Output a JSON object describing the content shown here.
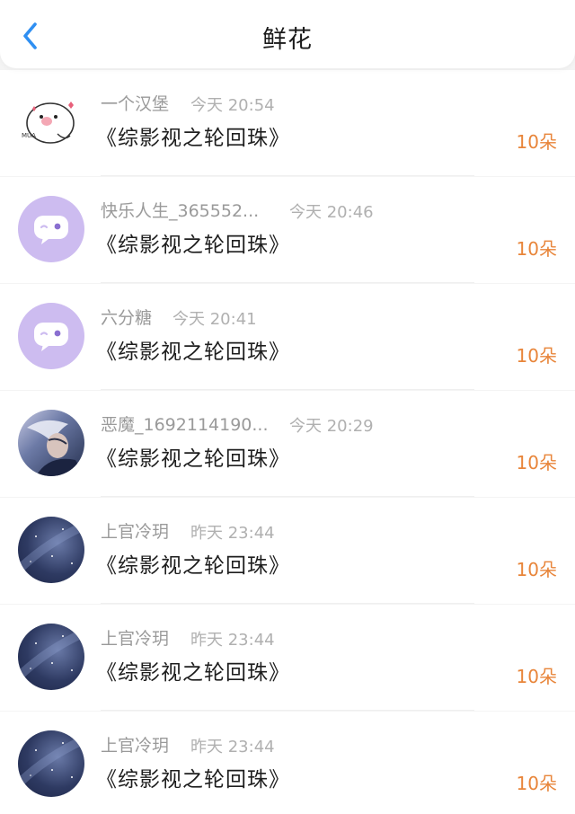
{
  "header": {
    "title": "鲜花",
    "accent_color": "#2f8ff2"
  },
  "items": [
    {
      "name": "一个汉堡",
      "time": "今天 20:54",
      "book": "《综影视之轮回珠》",
      "count": "10朵",
      "avatar": "cartoon-sticker"
    },
    {
      "name": "快乐人生_365552...",
      "time": "今天 20:46",
      "book": "《综影视之轮回珠》",
      "count": "10朵",
      "avatar": "purple-chat-bubble"
    },
    {
      "name": "六分糖",
      "time": "今天 20:41",
      "book": "《综影视之轮回珠》",
      "count": "10朵",
      "avatar": "purple-chat-bubble"
    },
    {
      "name": "恶魔_1692114190...",
      "time": "今天 20:29",
      "book": "《综影视之轮回珠》",
      "count": "10朵",
      "avatar": "anime-character"
    },
    {
      "name": "上官冷玥",
      "time": "昨天 23:44",
      "book": "《综影视之轮回珠》",
      "count": "10朵",
      "avatar": "starry-sky"
    },
    {
      "name": "上官冷玥",
      "time": "昨天 23:44",
      "book": "《综影视之轮回珠》",
      "count": "10朵",
      "avatar": "starry-sky"
    },
    {
      "name": "上官冷玥",
      "time": "昨天 23:44",
      "book": "《综影视之轮回珠》",
      "count": "10朵",
      "avatar": "starry-sky"
    }
  ]
}
